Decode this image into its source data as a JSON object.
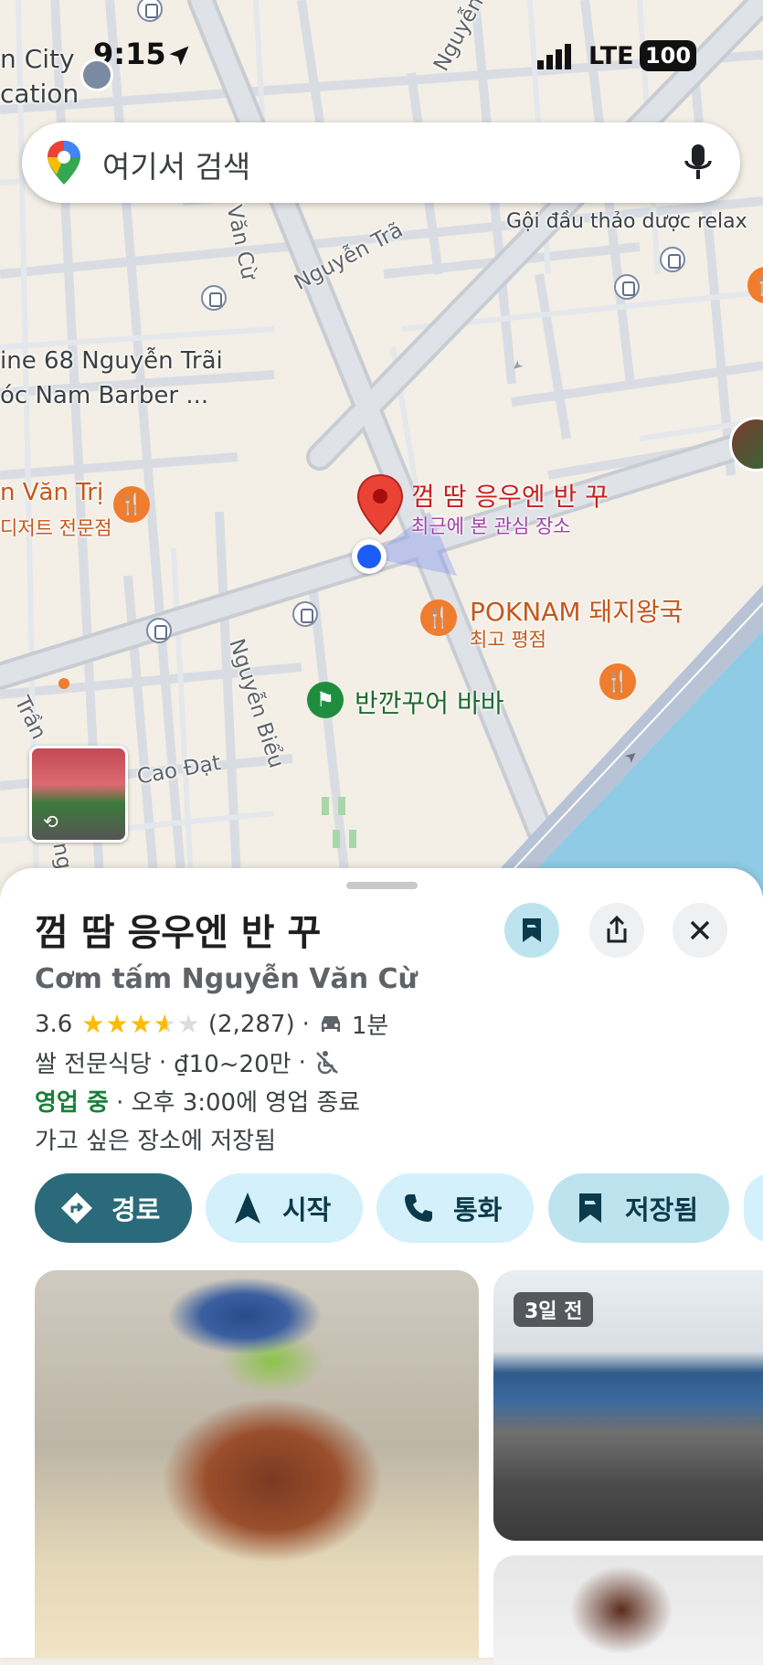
{
  "status": {
    "time": "9:15",
    "network": "LTE",
    "battery": "100"
  },
  "search": {
    "placeholder": "여기서 검색"
  },
  "map": {
    "labels": {
      "city": "n City",
      "education": "cation",
      "shampoo": "Gội đầu thảo dược relax",
      "road_nguyen_trai_top": "Nguyễn Trãi",
      "road_van_cu": "Văn Cừ",
      "road_nguyen_trai": "Nguyễn Trã",
      "place_68": "ine 68 Nguyễn Trãi",
      "barber": "óc Nam Barber ...",
      "van_tri": "n Văn Trị",
      "dessert": "디저트 전문점",
      "road_nguyen_bieu": "Nguyễn Biểu",
      "road_tran": "Trần",
      "road_cao_dat": "Cao Đạt",
      "road_ng": "ng"
    },
    "selected_pin": {
      "name": "껌 땀 응우엔 반 꾸",
      "sub": "최근에 본 관심 장소"
    },
    "poknam": {
      "name": "POKNAM 돼지왕국",
      "sub": "최고 평점"
    },
    "banh": {
      "name": "반깐꾸어 바바"
    }
  },
  "sheet": {
    "title": "껌 땀 응우엔 반 꾸",
    "subtitle": "Cơm tấm Nguyễn Văn Cừ",
    "rating": "3.6",
    "rating_value": 3.6,
    "reviews": "(2,287)",
    "drive_time": "1분",
    "category": "쌀 전문식당",
    "price": "₫10~20만",
    "open_status": "영업 중",
    "hours": "오후 3:00에 영업 종료",
    "saved_text": "가고 싶은 장소에 저장됨",
    "chips": {
      "directions": "경로",
      "start": "시작",
      "call": "통화",
      "saved": "저장됨"
    },
    "photo_badge": "3일 전"
  },
  "colors": {
    "accent_dark": "#2a6a7a",
    "chip_light": "#d4f1fb",
    "open_green": "#188038",
    "pin_red": "#ea4335",
    "poi_orange": "#f07c2e"
  }
}
